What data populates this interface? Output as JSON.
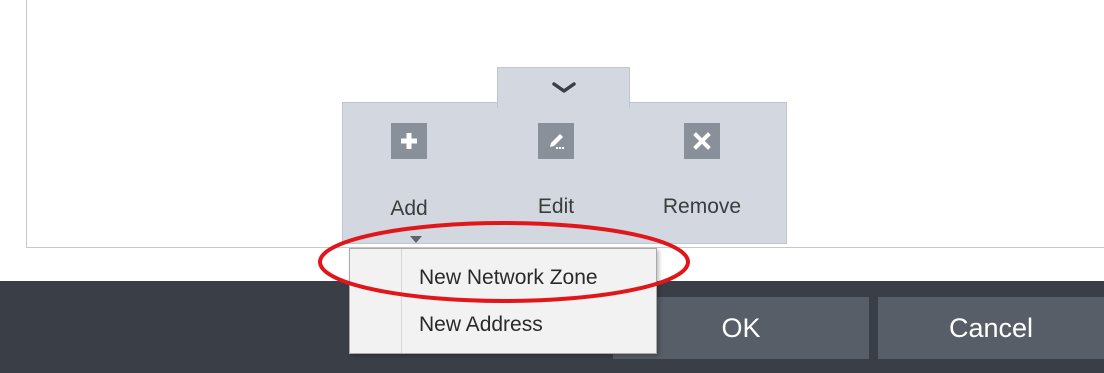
{
  "toolbar": {
    "add_label": "Add",
    "edit_label": "Edit",
    "remove_label": "Remove"
  },
  "dropdown": {
    "items": [
      {
        "label": "New Network Zone"
      },
      {
        "label": "New Address"
      }
    ]
  },
  "footer": {
    "ok_label": "OK",
    "cancel_label": "Cancel"
  },
  "colors": {
    "footer_bg": "#3a3f47",
    "button_bg": "#585e67",
    "toolbar_bg": "#d3d7df",
    "highlight": "#e0161b"
  },
  "icons": [
    "chevron-down-icon",
    "plus-icon",
    "pencil-icon",
    "x-icon"
  ]
}
